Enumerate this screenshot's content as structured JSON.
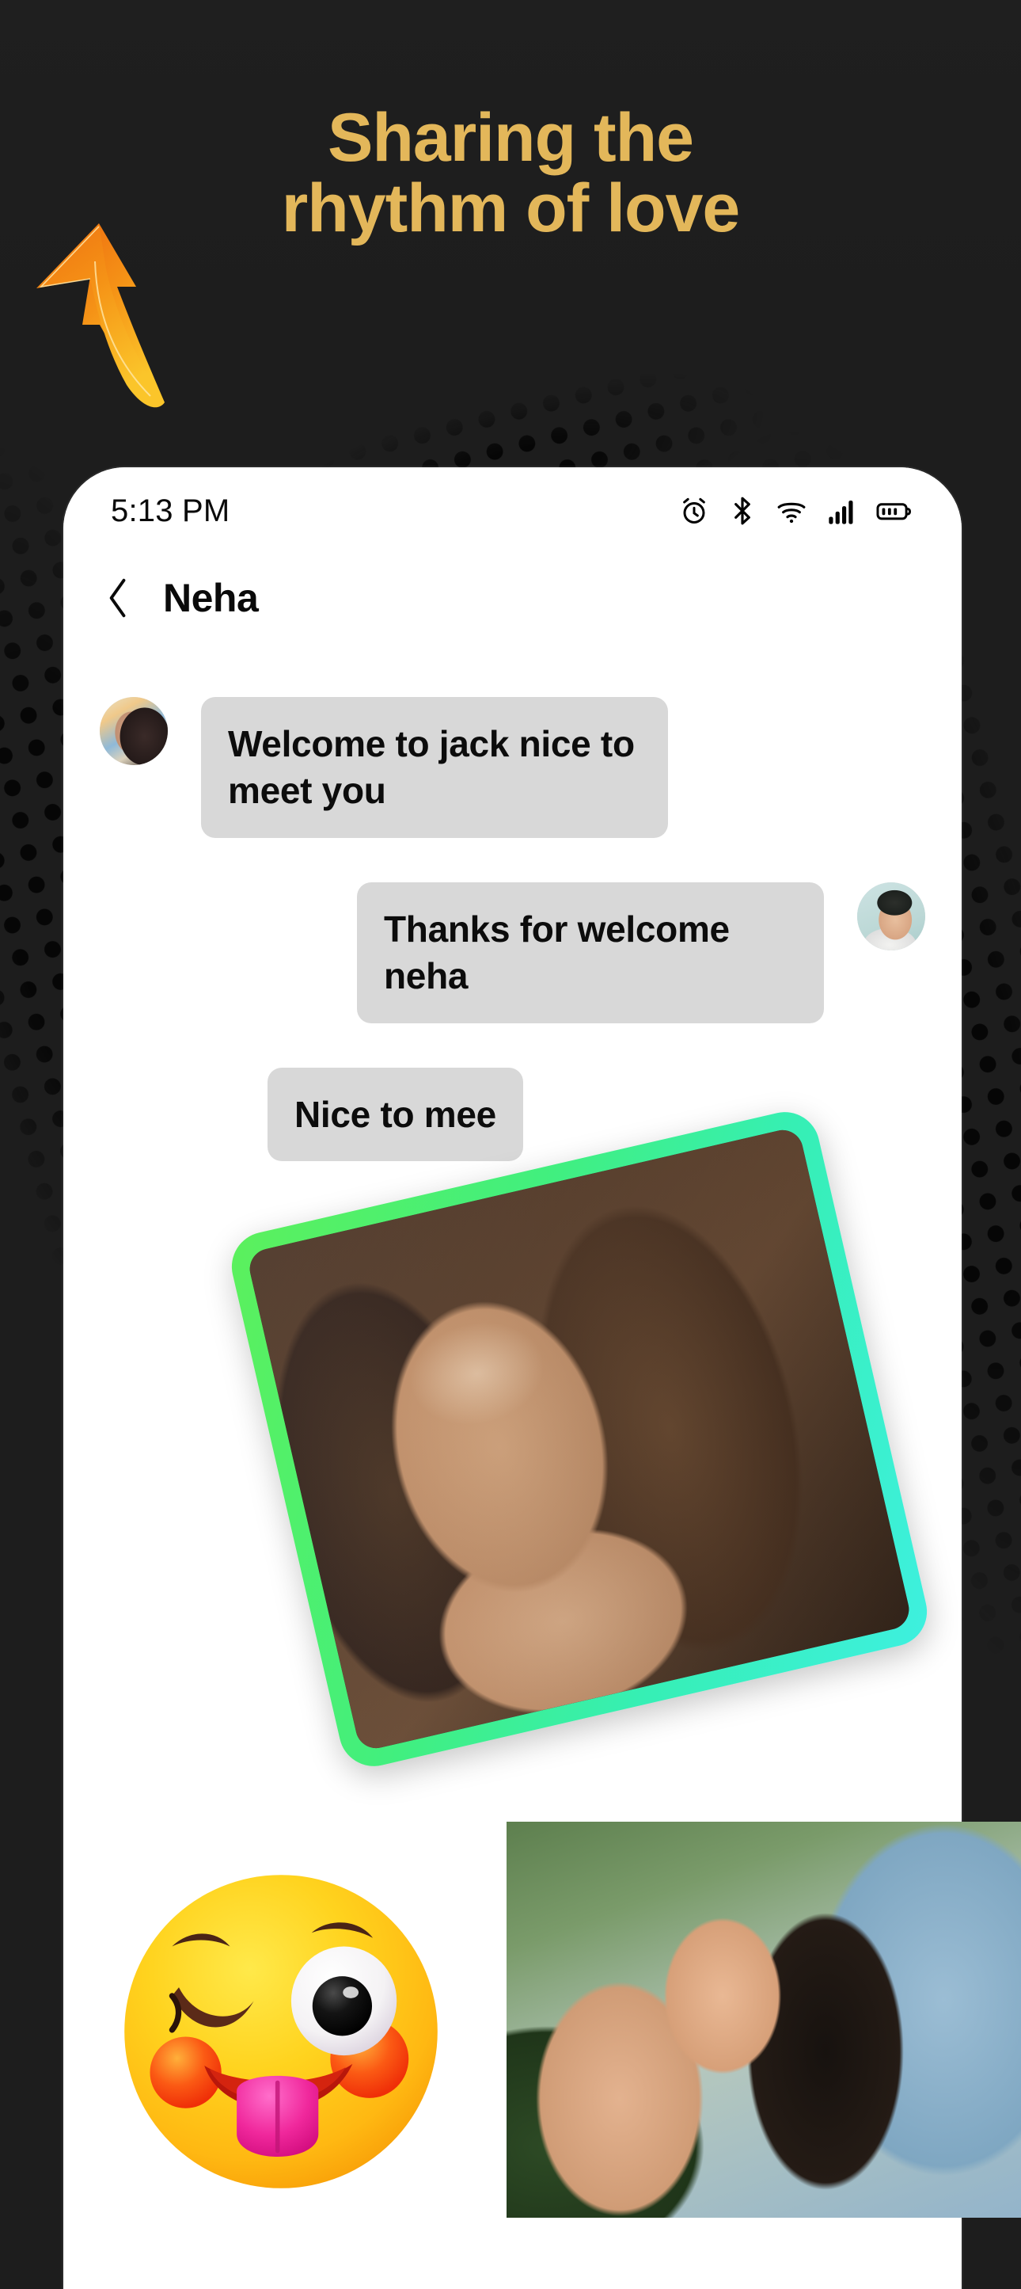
{
  "promo": {
    "headline_line1": "Sharing the",
    "headline_line2": "rhythm of love",
    "headline_color": "#e3b75a",
    "background_color": "#1d1d1d",
    "arrow_icon": "curved-up-arrow-icon",
    "arrow_color_start": "#f07818",
    "arrow_color_end": "#f7c12a"
  },
  "phone": {
    "status_bar": {
      "time": "5:13 PM",
      "icons": [
        "alarm-icon",
        "bluetooth-icon",
        "wifi-icon",
        "cellular-signal-icon",
        "battery-icon"
      ]
    },
    "header": {
      "back_icon": "chevron-left-icon",
      "title": "Neha"
    },
    "chat": {
      "bubble_color": "#d8d8d8",
      "messages": [
        {
          "id": "msg-1",
          "side": "left",
          "sender": "Neha",
          "text": "Welcome to jack nice to meet you",
          "avatar": "avatar-neha"
        },
        {
          "id": "msg-2",
          "side": "right",
          "sender": "Jack",
          "text": "Thanks for welcome neha",
          "avatar": "avatar-jack"
        },
        {
          "id": "msg-3",
          "side": "left",
          "sender": "Neha",
          "text": "Nice to mee",
          "avatar": null
        }
      ]
    }
  },
  "overlays": {
    "photo_card": {
      "name": "photo-card-portrait",
      "border_gradient_start": "#5cf05c",
      "border_gradient_end": "#3ef0e0",
      "rotation_deg": -13
    },
    "photo_secondary": {
      "name": "photo-secondary-portrait"
    },
    "emoji": {
      "name": "winking-face-with-tongue-emoji",
      "glyph": "😜"
    }
  }
}
